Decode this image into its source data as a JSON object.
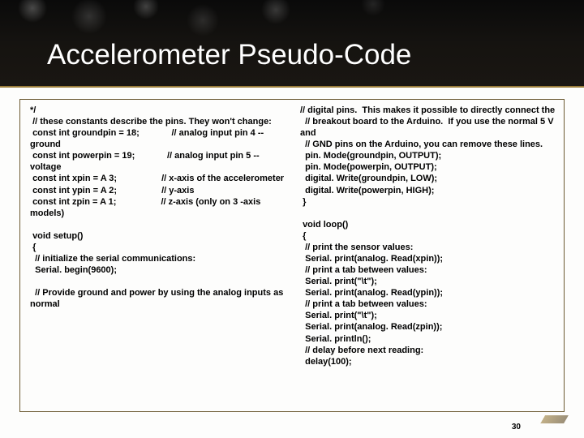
{
  "title": "Accelerometer Pseudo-Code",
  "columns": {
    "left": "*/\n // these constants describe the pins. They won't change:\n const int groundpin = 18;             // analog input pin 4 -- ground\n const int powerpin = 19;             // analog input pin 5 -- voltage\n const int xpin = A 3;                  // x-axis of the accelerometer\n const int ypin = A 2;                  // y-axis\n const int zpin = A 1;                  // z-axis (only on 3 -axis models)\n\n void setup()\n {\n  // initialize the serial communications:\n  Serial. begin(9600);\n\n  // Provide ground and power by using the analog inputs as normal",
    "right": "// digital pins.  This makes it possible to directly connect the\n  // breakout board to the Arduino.  If you use the normal 5 V and\n  // GND pins on the Arduino, you can remove these lines.\n  pin. Mode(groundpin, OUTPUT);\n  pin. Mode(powerpin, OUTPUT);\n  digital. Write(groundpin, LOW);\n  digital. Write(powerpin, HIGH);\n }\n\n void loop()\n {\n  // print the sensor values:\n  Serial. print(analog. Read(xpin));\n  // print a tab between values:\n  Serial. print(\"\\t\");\n  Serial. print(analog. Read(ypin));\n  // print a tab between values:\n  Serial. print(\"\\t\");\n  Serial. print(analog. Read(zpin));\n  Serial. println();\n  // delay before next reading:\n  delay(100);"
  },
  "page_number": "30"
}
